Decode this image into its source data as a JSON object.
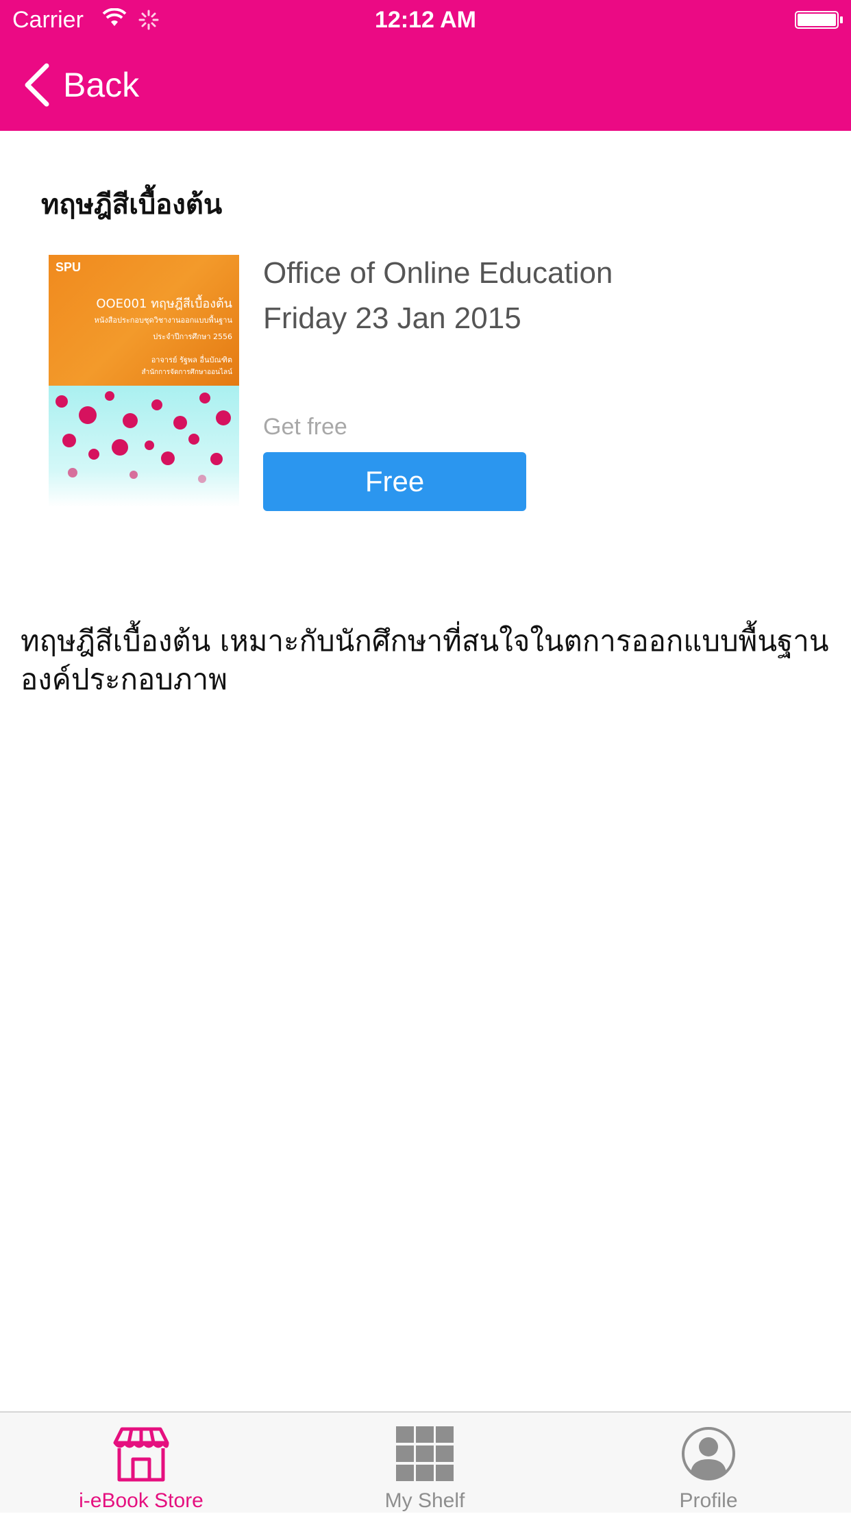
{
  "status_bar": {
    "carrier": "Carrier",
    "time": "12:12 AM",
    "icons": [
      "wifi-icon",
      "activity-spinner-icon",
      "battery-icon"
    ]
  },
  "nav": {
    "back_label": "Back",
    "color": "#eb0a84"
  },
  "book": {
    "title": "ทฤษฎีสีเบื้องต้น",
    "publisher": "Office of Online Education",
    "date": "Friday 23 Jan 2015",
    "price_caption": "Get free",
    "button_label": "Free",
    "button_color": "#2b96ef",
    "description": "ทฤษฎีสีเบื้องต้น เหมาะกับนักศึกษาที่สนใจในตการออกแบบพื้นฐาน องค์ประกอบภาพ",
    "cover": {
      "brand": "SPU",
      "title": "OOE001 ทฤษฎีสีเบื้องต้น",
      "line1": "หนังสือประกอบชุดวิชางานออกแบบพื้นฐาน",
      "line2": "ประจำปีการศึกษา 2556",
      "line3": "อาจารย์ รัฐพล อื่นบัณฑิต",
      "line4": "สำนักการจัดการศึกษาออนไลน์"
    }
  },
  "tabs": [
    {
      "label": "i-eBook Store",
      "icon": "store-icon",
      "active": true
    },
    {
      "label": "My Shelf",
      "icon": "grid-icon",
      "active": false
    },
    {
      "label": "Profile",
      "icon": "profile-icon",
      "active": false
    }
  ],
  "colors": {
    "accent": "#eb0a84",
    "active_tab": "#e5107f",
    "inactive_tab": "#8e8e8e"
  }
}
